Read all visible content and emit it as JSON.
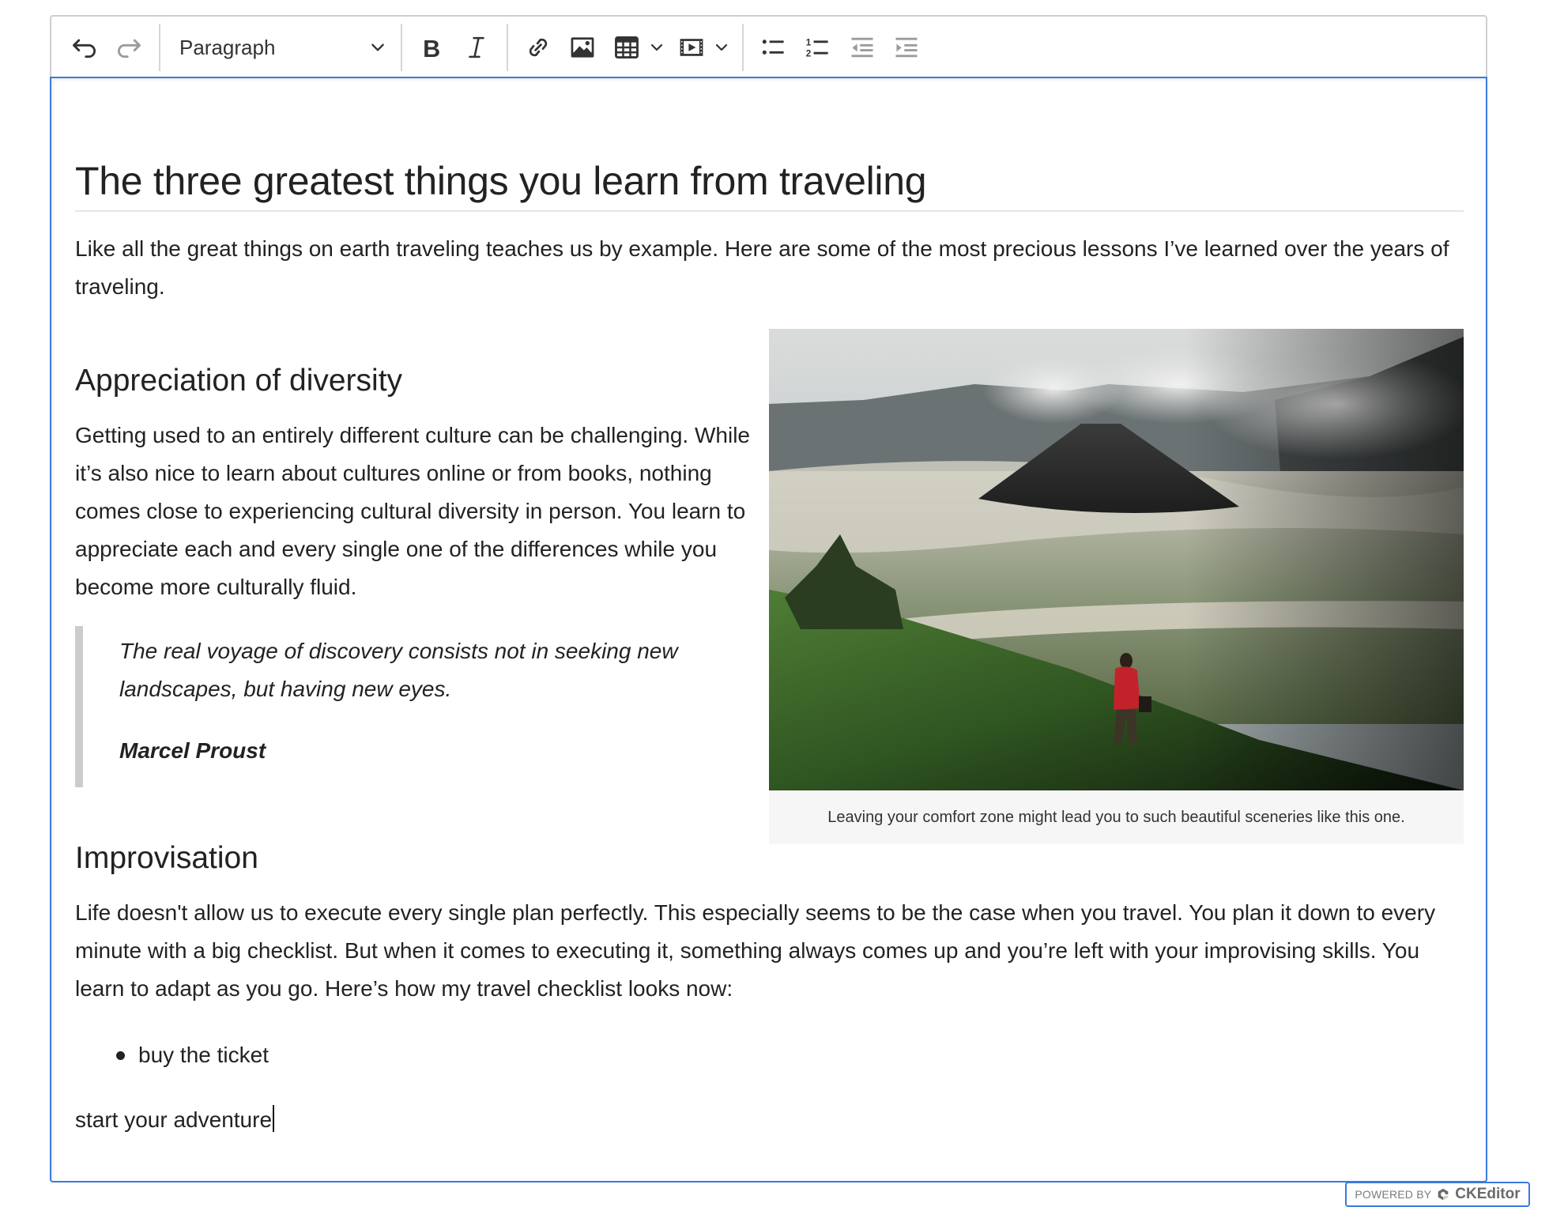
{
  "toolbar": {
    "undo": {
      "icon": "undo-icon",
      "enabled": true
    },
    "redo": {
      "icon": "redo-icon",
      "enabled": false
    },
    "heading_dropdown": {
      "selected": "Paragraph"
    },
    "bold": {
      "icon": "bold-icon"
    },
    "italic": {
      "icon": "italic-icon"
    },
    "link": {
      "icon": "link-icon"
    },
    "image": {
      "icon": "image-icon"
    },
    "table": {
      "icon": "table-icon"
    },
    "media": {
      "icon": "media-embed-icon"
    },
    "bulleted_list": {
      "icon": "bulleted-list-icon"
    },
    "numbered_list": {
      "icon": "numbered-list-icon"
    },
    "outdent": {
      "icon": "outdent-icon",
      "enabled": false
    },
    "indent": {
      "icon": "indent-icon",
      "enabled": false
    },
    "colors": {
      "text": "#333333",
      "disabled": "#9b9b9b",
      "focus_border": "#3a7bdc"
    }
  },
  "document": {
    "title": "The three greatest things you learn from traveling",
    "intro": "Like all the great things on earth traveling teaches us by example. Here are some of the most precious lessons I’ve learned over the years of traveling.",
    "sections": [
      {
        "heading": "Appreciation of diversity",
        "paragraph": "Getting used to an entirely different culture can be challenging. While it’s also nice to learn about cultures online or from books, nothing comes close to experiencing cultural diversity in person. You learn to appreciate each and every single one of the differences while you become more culturally fluid.",
        "quote": {
          "text": "The real voyage of discovery consists not in seeking new landscapes, but having new eyes.",
          "author": "Marcel Proust"
        }
      },
      {
        "heading": "Improvisation",
        "paragraph": "Life doesn't allow us to execute every single plan perfectly. This especially seems to be the case when you travel. You plan it down to every minute with a big checklist. But when it comes to executing it, something always comes up and you’re left with your improvising skills. You learn to adapt as you go. Here’s how my travel checklist looks now:",
        "list": [
          "buy the ticket"
        ]
      }
    ],
    "last_paragraph": "start your adventure",
    "figure": {
      "image_alt": "Volcano landscape with a hiker in a red jacket on a grassy slope",
      "caption": "Leaving your comfort zone might lead you to such beautiful sceneries like this one."
    }
  },
  "badge": {
    "powered_by": "POWERED BY",
    "brand": "CKEditor"
  }
}
